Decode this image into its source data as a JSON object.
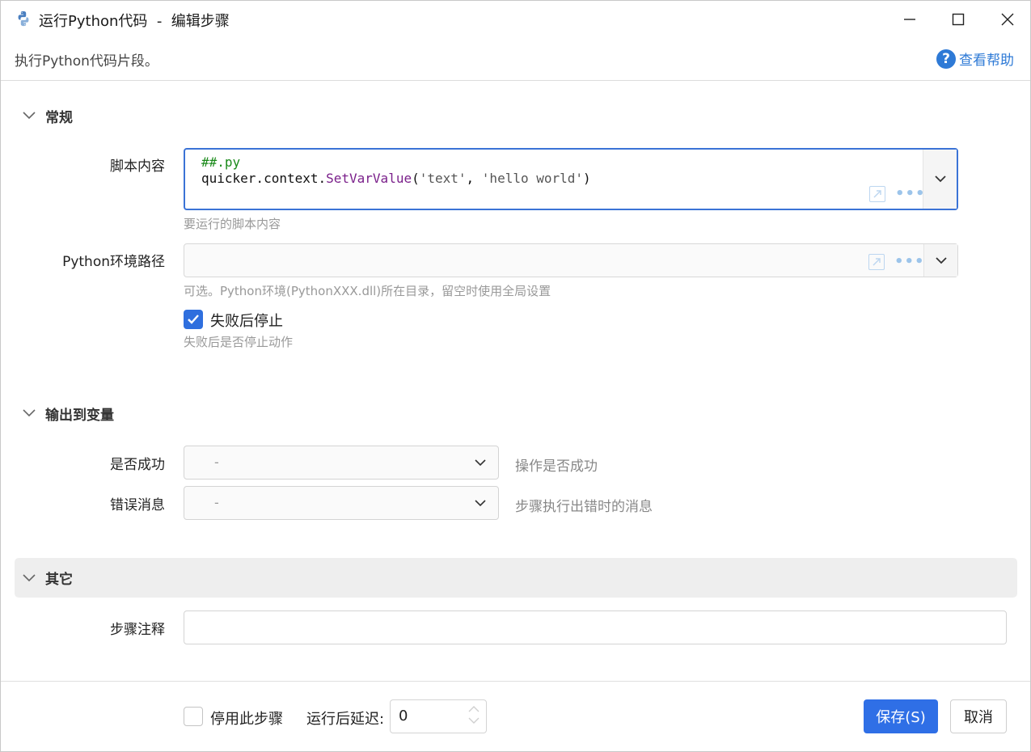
{
  "window": {
    "title": "运行Python代码  -  编辑步骤",
    "subtitle": "执行Python代码片段。",
    "help_label": "查看帮助"
  },
  "sections": {
    "general": "常规",
    "output": "输出到变量",
    "other": "其它"
  },
  "script": {
    "label": "脚本内容",
    "line1": "##.py",
    "line2_obj": "quicker.context.",
    "line2_func": "SetVarValue",
    "line2_open": "(",
    "line2_arg1": "'text'",
    "line2_sep": ", ",
    "line2_arg2": "'hello world'",
    "line2_close": ")",
    "hint": "要运行的脚本内容"
  },
  "python_path": {
    "label": "Python环境路径",
    "value": "",
    "hint": "可选。Python环境(PythonXXX.dll)所在目录，留空时使用全局设置"
  },
  "stop_on_fail": {
    "label": "失败后停止",
    "checked": true,
    "hint": "失败后是否停止动作"
  },
  "outputs": {
    "success": {
      "label": "是否成功",
      "value": "-",
      "note": "操作是否成功"
    },
    "error": {
      "label": "错误消息",
      "value": "-",
      "note": "步骤执行出错时的消息"
    }
  },
  "other": {
    "note_label": "步骤注释",
    "note_value": ""
  },
  "footer": {
    "disable_label": "停用此步骤",
    "disable_checked": false,
    "delay_label": "运行后延迟:",
    "delay_value": "0",
    "save_label": "保存(S)",
    "cancel_label": "取消"
  },
  "colors": {
    "accent": "#2f6fe6",
    "help": "#2e7ad6"
  },
  "icons": {
    "app": "python-logo-icon",
    "minimize": "minimize-icon",
    "maximize": "maximize-icon",
    "close": "close-icon",
    "help": "question-circle-icon",
    "expand": "expand-icon",
    "more": "more-dots-icon",
    "chevron": "chevron-down-icon"
  }
}
